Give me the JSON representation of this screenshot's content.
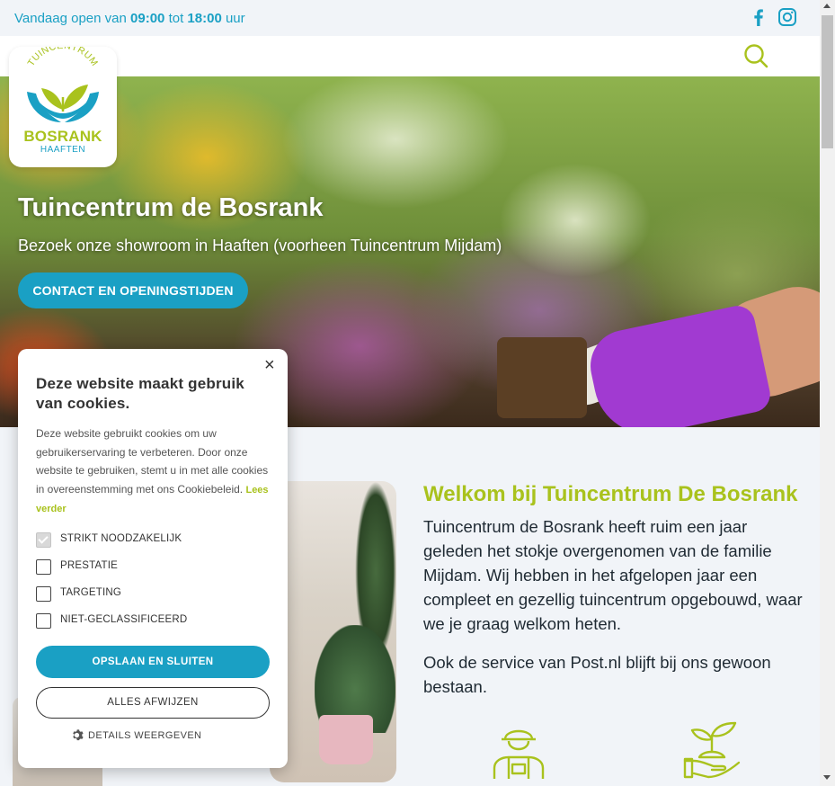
{
  "topbar": {
    "hours_prefix": "Vandaag open van",
    "open_time": "09:00",
    "hours_mid": "tot",
    "close_time": "18:00",
    "hours_suffix": "uur"
  },
  "logo": {
    "arc_text": "TUINCENTRUM",
    "brand": "BOSRANK",
    "sub": "HAAFTEN"
  },
  "hero": {
    "title": "Tuincentrum de Bosrank",
    "tagline": "Bezoek onze showroom in Haaften (voorheen Tuincentrum Mijdam)",
    "cta_label": "CONTACT EN OPENINGSTIJDEN"
  },
  "main": {
    "welcome_title": "Welkom bij Tuincentrum De Bosrank",
    "paragraph1": "Tuincentrum de Bosrank heeft ruim een jaar geleden het stokje overgenomen van de familie Mijdam.  Wij hebben in het afgelopen jaar een compleet en gezellig tuincentrum opgebouwd, waar we je graag welkom heten.",
    "paragraph2": "Ook de service van Post.nl blijft bij ons gewoon bestaan."
  },
  "cookie": {
    "close_label": "×",
    "title": "Deze website maakt gebruik van cookies.",
    "body": "Deze website gebruikt cookies om uw gebruikerservaring te verbeteren. Door onze website te gebruiken, stemt u in met alle cookies in overeenstemming met ons Cookiebeleid.",
    "read_more": "Lees verder",
    "options": [
      {
        "label": "STRIKT NOODZAKELIJK",
        "checked": true,
        "disabled": true
      },
      {
        "label": "PRESTATIE",
        "checked": false,
        "disabled": false
      },
      {
        "label": "TARGETING",
        "checked": false,
        "disabled": false
      },
      {
        "label": "NIET-GECLASSIFICEERD",
        "checked": false,
        "disabled": false
      }
    ],
    "save_label": "OPSLAAN EN SLUITEN",
    "reject_label": "ALLES AFWIJZEN",
    "details_label": "DETAILS WEERGEVEN"
  },
  "colors": {
    "accent_blue": "#1aa0c4",
    "accent_green": "#a9c21d"
  },
  "icons": [
    "facebook-icon",
    "instagram-icon",
    "search-icon",
    "gardener-icon",
    "plant-in-hand-icon",
    "gear-icon",
    "close-icon"
  ]
}
